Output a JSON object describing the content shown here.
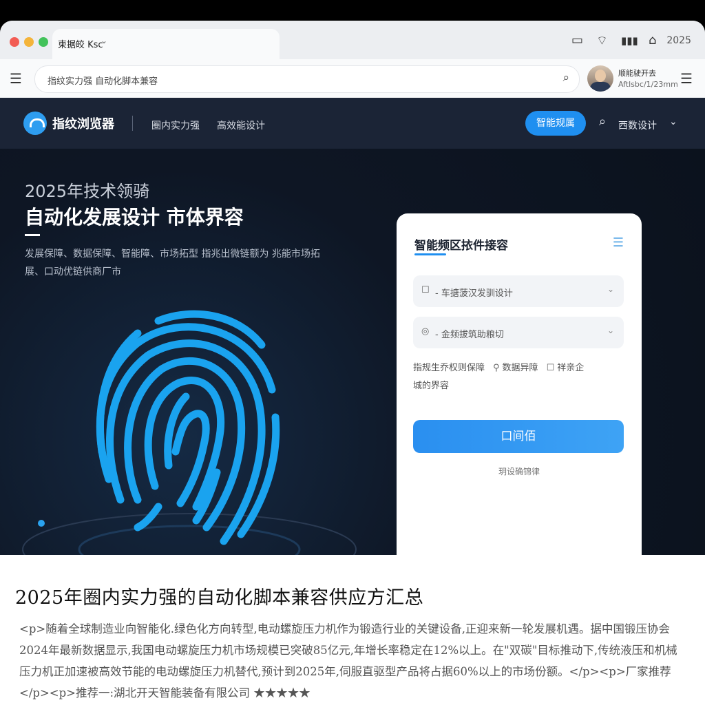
{
  "browser": {
    "tab_title": "柬据皎 Ksc",
    "tab_chevron": "⌄",
    "toolbar_year": "2025",
    "address_text": "指纹实力强 自动化脚本兼容",
    "user_name": "顺能驶开去",
    "user_sub": "Aftlsbc/1/23mm"
  },
  "site": {
    "logo_text": "指纹浏览器",
    "nav": [
      "圈内实力强",
      "高效能设计"
    ],
    "cta_label": "智能规属",
    "header_link": "西数设计"
  },
  "hero": {
    "pretitle": "2025年技术领骑",
    "title": "自动化发展设计  市体界容",
    "description": "发展保障、数据保障、智能障、市场拓型  指兆出微链额为 兆能市场拓展、口动优链供商厂市"
  },
  "card": {
    "title": "智能频区挔件接容",
    "field1": "- 车搪菠汉发驯设计",
    "field2": "- 金频拔筑助粮切",
    "options_text": "指规生乔权则保障",
    "option2": "数据异障",
    "option3": "祥亲企",
    "options_line2": "城的界容",
    "submit_label": "口间佰",
    "footer": "玥设确锦律"
  },
  "article": {
    "title": "2025年圈内实力强的自动化脚本兼容供应方汇总",
    "body": "<p>随着全球制造业向智能化.绿色化方向转型,电动螺旋压力机作为锻造行业的关键设备,正迎来新一轮发展机遇。据中国锻压协会2024年最新数据显示,我国电动螺旋压力机市场规模已突破85亿元,年增长率稳定在12%以上。在\"双碳\"目标推动下,传统液压和机械压力机正加速被高效节能的电动螺旋压力机替代,预计到2025年,伺服直驱型产品将占据60%以上的市场份额。</p><p>厂家推荐</p><p>推荐一:湖北开天智能装备有限公司 ★★★★★"
  },
  "colors": {
    "accent": "#1f8ff0",
    "header_bg": "#1b2436",
    "hero_bg": "#0e1624",
    "fingerprint": "#1aa3ef"
  },
  "icons": [
    "book-icon",
    "wifi-icon",
    "signal-icon",
    "home-icon",
    "search-icon",
    "menu-icon",
    "chevron-down-icon",
    "fingerprint-icon"
  ]
}
